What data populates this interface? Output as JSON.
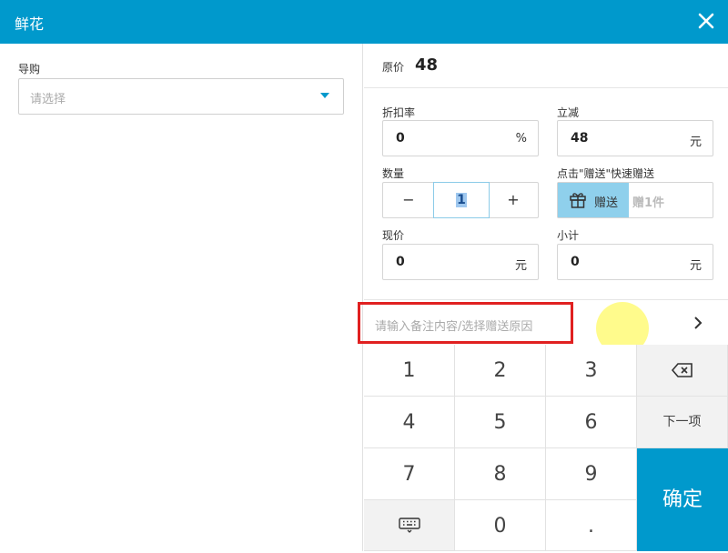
{
  "dialog": {
    "title": "鲜花"
  },
  "guide": {
    "label": "导购",
    "placeholder": "请选择"
  },
  "original_price": {
    "label": "原价",
    "value": "48"
  },
  "discount": {
    "label": "折扣率",
    "value": "0",
    "unit": "%"
  },
  "reduce": {
    "label": "立减",
    "value": "48",
    "unit": "元"
  },
  "quantity": {
    "label": "数量",
    "value": "1",
    "minus": "−",
    "plus": "+"
  },
  "gift": {
    "label": "点击\"赠送\"快速赠送",
    "button": "赠送",
    "placeholder": "赠1件"
  },
  "current_price": {
    "label": "现价",
    "value": "0",
    "unit": "元"
  },
  "subtotal": {
    "label": "小计",
    "value": "0",
    "unit": "元"
  },
  "remark": {
    "placeholder": "请输入备注内容/选择赠送原因"
  },
  "keypad": {
    "k1": "1",
    "k2": "2",
    "k3": "3",
    "k4": "4",
    "k5": "5",
    "k6": "6",
    "k7": "7",
    "k8": "8",
    "k9": "9",
    "k0": "0",
    "dot": ".",
    "next": "下一项",
    "confirm": "确定"
  },
  "colors": {
    "accent": "#0099cc",
    "gift": "#8fd0ec",
    "highlight": "#e02020"
  },
  "icons": [
    "close-icon",
    "caret-down-icon",
    "gift-icon",
    "chevron-right-icon",
    "backspace-icon",
    "keyboard-icon"
  ]
}
